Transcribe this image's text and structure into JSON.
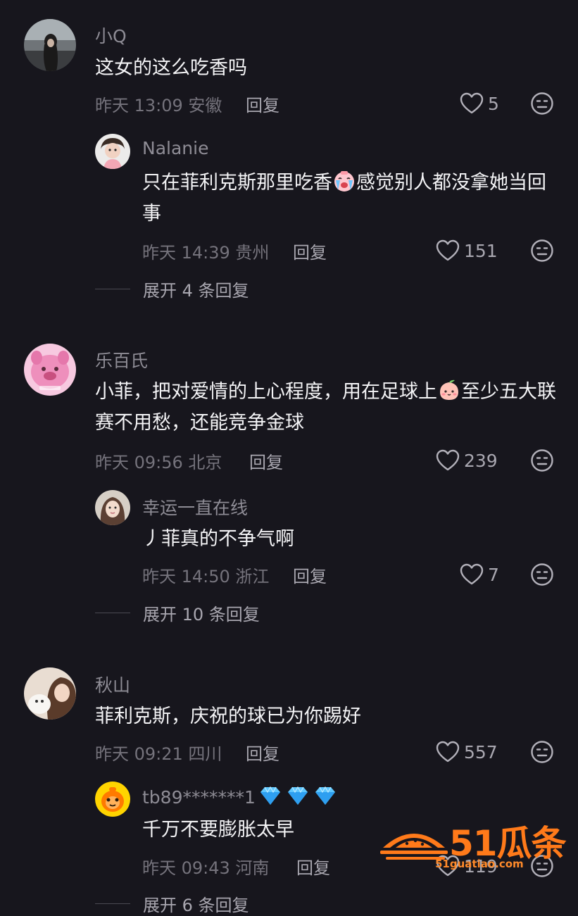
{
  "actions": {
    "reply_label": "回复",
    "dislike_icon": "frown-face-icon",
    "like_icon": "heart-outline-icon"
  },
  "comments": [
    {
      "username": "小Q",
      "text": "这女的这么吃香吗",
      "meta": "昨天 13:09 安徽",
      "likes": "5",
      "avatar_icon": "user-avatar-photo",
      "replies": [
        {
          "username": "Nalanie",
          "text_part1": "只在菲利克斯那里吃香",
          "emoji": "crying-face-emoji",
          "text_part2": "感觉别人都没拿她当回事",
          "meta": "昨天 14:39 贵州",
          "likes": "151"
        }
      ],
      "expand_label": "展开 4 条回复"
    },
    {
      "username": "乐百氏",
      "text_part1": "小菲，把对爱情的上心程度，用在足球上",
      "emoji": "peach-face-emoji",
      "text_part2": "至少五大联赛不用愁，还能竞争金球",
      "meta": "昨天 09:56 北京",
      "likes": "239",
      "replies": [
        {
          "username": "幸运一直在线",
          "text": "丿菲真的不争气啊",
          "meta": "昨天 14:50 浙江",
          "likes": "7"
        }
      ],
      "expand_label": "展开 10 条回复"
    },
    {
      "username": "秋山",
      "text": "菲利克斯，庆祝的球已为你踢好",
      "meta": "昨天 09:21 四川",
      "likes": "557",
      "replies": [
        {
          "username": "tb89*******1",
          "badges": [
            "diamond-icon",
            "diamond-icon",
            "diamond-icon"
          ],
          "text": "千万不要膨胀太早",
          "meta": "昨天 09:43 河南",
          "likes": "119"
        }
      ],
      "expand_label": "展开 6 条回复"
    }
  ],
  "watermark": {
    "brand": "51瓜条",
    "site": "51guatiao.com",
    "color": "#ff7a1a"
  },
  "colors": {
    "background": "#17161d",
    "text": "#f4f4f6",
    "muted": "#75737c",
    "username": "#8e8c95"
  }
}
